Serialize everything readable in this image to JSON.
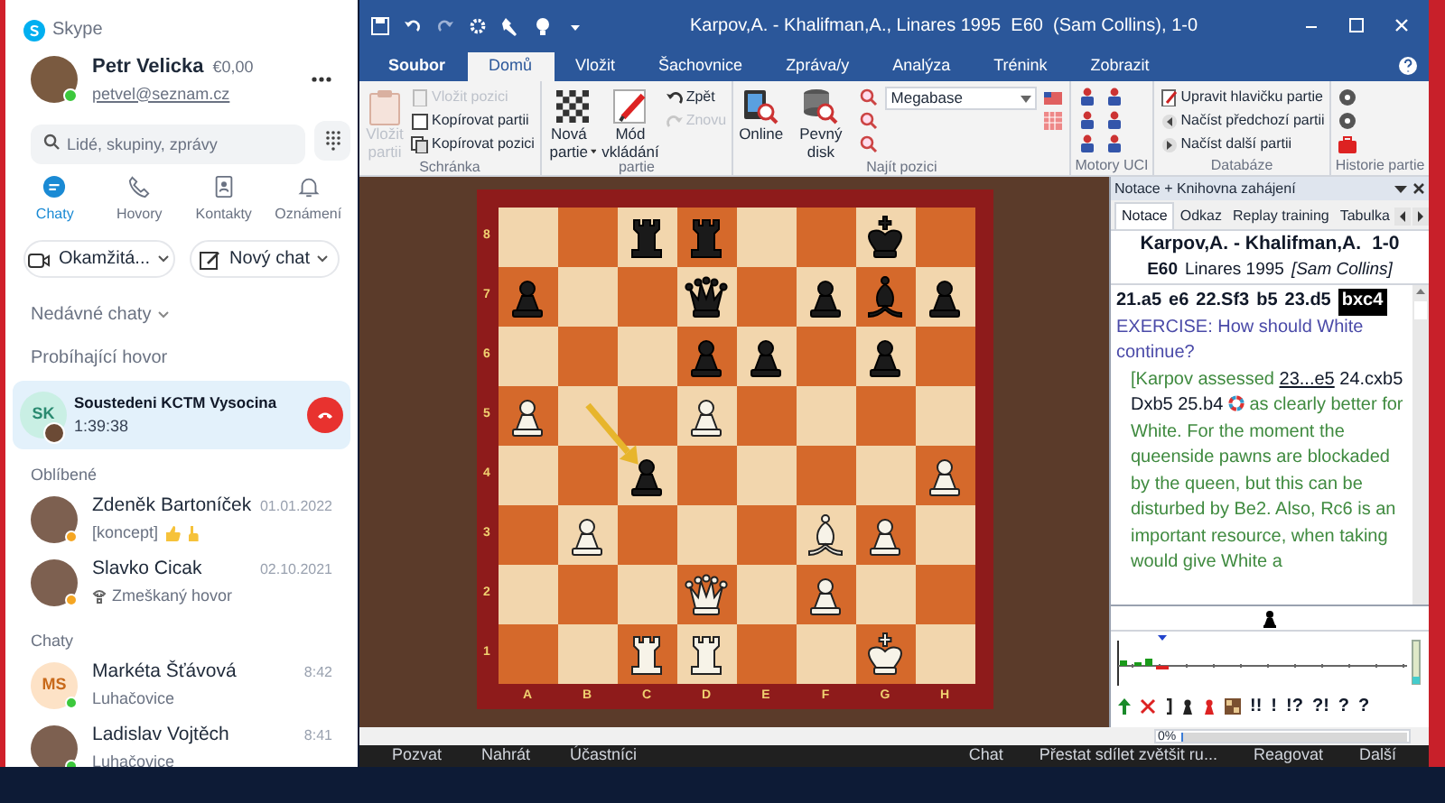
{
  "skype": {
    "app_title": "Skype",
    "profile": {
      "name": "Petr Velicka",
      "credit": "€0,00",
      "email": "petvel@seznam.cz",
      "color": "#3cc83c"
    },
    "search": {
      "placeholder": "Lidé, skupiny, zprávy"
    },
    "nav": [
      {
        "label": "Chaty",
        "selected": true
      },
      {
        "label": "Hovory",
        "selected": false
      },
      {
        "label": "Kontakty",
        "selected": false
      },
      {
        "label": "Oznámení",
        "selected": false
      }
    ],
    "actions": [
      {
        "label": "Okamžitá..."
      },
      {
        "label": "Nový chat"
      }
    ],
    "recent_label": "Nedávné chaty",
    "call_section": "Probíhající hovor",
    "active_call": {
      "initials": "SK",
      "name": "Soustedeni KCTM Vysocina",
      "duration": "1:39:38"
    },
    "sections": [
      {
        "title": "Oblíbené",
        "chats": [
          {
            "name": "Zdeněk Bartoníček",
            "date": "01.01.2022",
            "preview": "[koncept]",
            "kind": "draft",
            "color": "#f5a623"
          },
          {
            "name": "Slavko Cicak",
            "date": "02.10.2021",
            "preview": "Zmeškaný hovor",
            "kind": "missed-call",
            "color": "#f5a623"
          }
        ]
      },
      {
        "title": "Chaty",
        "chats": [
          {
            "name": "Markéta Šťávová",
            "initials": "MS",
            "date": "8:42",
            "preview": "Luhačovice",
            "kind": "text",
            "color": "#3cc83c"
          },
          {
            "name": "Ladislav Vojtěch",
            "date": "8:41",
            "preview": "Luhačovice",
            "kind": "text",
            "color": "#3cc83c"
          }
        ]
      }
    ]
  },
  "chessbase": {
    "title": "Karpov,A. - Khalifman,A., Linares 1995  E60  (Sam Collins), 1-0",
    "tabs": [
      {
        "label": "Soubor",
        "kind": "file",
        "selected": false
      },
      {
        "label": "Domů",
        "kind": "tab",
        "selected": true
      },
      {
        "label": "Vložit",
        "kind": "tab",
        "selected": false
      },
      {
        "label": "Šachovnice",
        "kind": "tab",
        "selected": false
      },
      {
        "label": "Zpráva/y",
        "kind": "tab",
        "selected": false
      },
      {
        "label": "Analýza",
        "kind": "tab",
        "selected": false
      },
      {
        "label": "Trénink",
        "kind": "tab",
        "selected": false
      },
      {
        "label": "Zobrazit",
        "kind": "tab",
        "selected": false
      }
    ],
    "ribbon": [
      {
        "label": "Schránka",
        "buttons": [
          {
            "kind": "large",
            "label": "Vložit partii",
            "disabled": true
          },
          {
            "kind": "small",
            "label": "Vložit pozici",
            "disabled": true
          },
          {
            "kind": "small",
            "label": "Kopírovat partii",
            "disabled": false
          },
          {
            "kind": "small",
            "label": "Kopírovat pozici",
            "disabled": false
          }
        ]
      },
      {
        "label": "partie",
        "buttons": [
          {
            "kind": "large",
            "label": "Nová partie",
            "disabled": false,
            "has_menu": true
          },
          {
            "kind": "large",
            "label": "Mód vkládání",
            "disabled": false
          },
          {
            "kind": "small",
            "label": "Zpět",
            "disabled": false
          },
          {
            "kind": "small",
            "label": "Znovu",
            "disabled": true
          }
        ]
      },
      {
        "label": "Najít pozici",
        "buttons": [
          {
            "kind": "large",
            "label": "Online",
            "disabled": false
          },
          {
            "kind": "large",
            "label": "Pevný disk",
            "disabled": false
          },
          {
            "kind": "icon",
            "disabled": false
          },
          {
            "kind": "icon",
            "disabled": false
          },
          {
            "kind": "icon",
            "disabled": false
          },
          {
            "kind": "combo",
            "value": "Megabase",
            "disabled": false
          },
          {
            "kind": "icon",
            "disabled": false
          },
          {
            "kind": "icon",
            "disabled": false
          }
        ]
      },
      {
        "label": "Motory UCI",
        "buttons": [
          {
            "kind": "icon",
            "disabled": false
          },
          {
            "kind": "icon",
            "disabled": false
          },
          {
            "kind": "icon",
            "disabled": false
          },
          {
            "kind": "icon",
            "disabled": false
          },
          {
            "kind": "icon",
            "disabled": false
          },
          {
            "kind": "icon",
            "disabled": false
          }
        ]
      },
      {
        "label": "Databáze",
        "buttons": [
          {
            "kind": "small",
            "label": "Upravit hlavičku partie",
            "disabled": false
          },
          {
            "kind": "small",
            "label": "Načíst předchozí partii",
            "disabled": false
          },
          {
            "kind": "small",
            "label": "Načíst další partii",
            "disabled": false
          }
        ]
      },
      {
        "label": "Historie partie",
        "buttons": [
          {
            "kind": "icon",
            "disabled": false
          },
          {
            "kind": "icon",
            "disabled": false
          },
          {
            "kind": "icon",
            "disabled": false
          }
        ]
      }
    ],
    "board": {
      "ranks": [
        "8",
        "7",
        "6",
        "5",
        "4",
        "3",
        "2",
        "1"
      ],
      "files": [
        "A",
        "B",
        "C",
        "D",
        "E",
        "F",
        "G",
        "H"
      ],
      "rows": [
        {
          "cells": [
            {
              "kind": "empty"
            },
            {
              "kind": "empty"
            },
            {
              "kind": "rook",
              "white": false
            },
            {
              "kind": "rook",
              "white": false
            },
            {
              "kind": "empty"
            },
            {
              "kind": "empty"
            },
            {
              "kind": "king",
              "white": false
            },
            {
              "kind": "empty"
            }
          ]
        },
        {
          "cells": [
            {
              "kind": "pawn",
              "white": false
            },
            {
              "kind": "empty"
            },
            {
              "kind": "empty"
            },
            {
              "kind": "queen",
              "white": false
            },
            {
              "kind": "empty"
            },
            {
              "kind": "pawn",
              "white": false
            },
            {
              "kind": "bishop",
              "white": false
            },
            {
              "kind": "pawn",
              "white": false
            }
          ]
        },
        {
          "cells": [
            {
              "kind": "empty"
            },
            {
              "kind": "empty"
            },
            {
              "kind": "empty"
            },
            {
              "kind": "pawn",
              "white": false
            },
            {
              "kind": "pawn",
              "white": false
            },
            {
              "kind": "empty"
            },
            {
              "kind": "pawn",
              "white": false
            },
            {
              "kind": "empty"
            }
          ]
        },
        {
          "cells": [
            {
              "kind": "pawn",
              "white": true
            },
            {
              "kind": "empty",
              "arrow_start": true
            },
            {
              "kind": "empty"
            },
            {
              "kind": "pawn",
              "white": true
            },
            {
              "kind": "empty"
            },
            {
              "kind": "empty"
            },
            {
              "kind": "empty"
            },
            {
              "kind": "empty"
            }
          ]
        },
        {
          "cells": [
            {
              "kind": "empty"
            },
            {
              "kind": "empty"
            },
            {
              "kind": "pawn",
              "white": false,
              "arrow_end": true
            },
            {
              "kind": "empty"
            },
            {
              "kind": "empty"
            },
            {
              "kind": "empty"
            },
            {
              "kind": "empty"
            },
            {
              "kind": "pawn",
              "white": true
            }
          ]
        },
        {
          "cells": [
            {
              "kind": "empty"
            },
            {
              "kind": "pawn",
              "white": true
            },
            {
              "kind": "empty"
            },
            {
              "kind": "empty"
            },
            {
              "kind": "empty"
            },
            {
              "kind": "bishop",
              "white": true
            },
            {
              "kind": "pawn",
              "white": true
            },
            {
              "kind": "empty"
            }
          ]
        },
        {
          "cells": [
            {
              "kind": "empty"
            },
            {
              "kind": "empty"
            },
            {
              "kind": "empty"
            },
            {
              "kind": "queen",
              "white": true
            },
            {
              "kind": "empty"
            },
            {
              "kind": "pawn",
              "white": true
            },
            {
              "kind": "empty"
            },
            {
              "kind": "empty"
            }
          ]
        },
        {
          "cells": [
            {
              "kind": "empty"
            },
            {
              "kind": "empty"
            },
            {
              "kind": "rook",
              "white": true
            },
            {
              "kind": "rook",
              "white": true
            },
            {
              "kind": "empty"
            },
            {
              "kind": "empty"
            },
            {
              "kind": "king",
              "white": true
            },
            {
              "kind": "empty"
            }
          ]
        }
      ]
    },
    "panel": {
      "title": "Notace + Knihovna zahájení",
      "tabs": [
        {
          "label": "Notace",
          "selected": true
        },
        {
          "label": "Odkaz",
          "selected": false
        },
        {
          "label": "Replay training",
          "selected": false
        },
        {
          "label": "Tabulka",
          "selected": false
        }
      ],
      "game": {
        "players": "Karpov,A. - Khalifman,A.",
        "result": "1-0",
        "eco": "E60",
        "event": "Linares 1995",
        "annotator": "[Sam Collins]"
      },
      "moves": [
        {
          "text": "21.a5",
          "selected": false
        },
        {
          "text": "e6",
          "selected": false
        },
        {
          "text": "22.Sf3",
          "selected": false
        },
        {
          "text": "b5",
          "selected": false
        },
        {
          "text": "23.d5",
          "selected": false
        },
        {
          "text": "bxc4",
          "selected": true
        }
      ],
      "exercise": "EXERCISE: How should White continue?",
      "annotation": {
        "open": "[Karpov assessed",
        "link": "23...e5",
        "variation": "24.cxb5 Dxb5 25.b4",
        "text": "as clearly better for White. For the moment the queenside pawns are blockaded by the queen, but this can be disturbed by Be2. Also, Rc6 is an important resource, when taking would give White a"
      },
      "symbols": [
        "!!",
        "!",
        "!?",
        "?!",
        "?",
        "?"
      ],
      "progress": "0%",
      "level": 0
    },
    "call_bar": {
      "left": [
        "Pozvat",
        "Nahrát",
        "Účastníci"
      ],
      "right": [
        "Chat",
        "Přestat sdílet zvětšit ru...",
        "Reagovat",
        "Další"
      ]
    }
  }
}
